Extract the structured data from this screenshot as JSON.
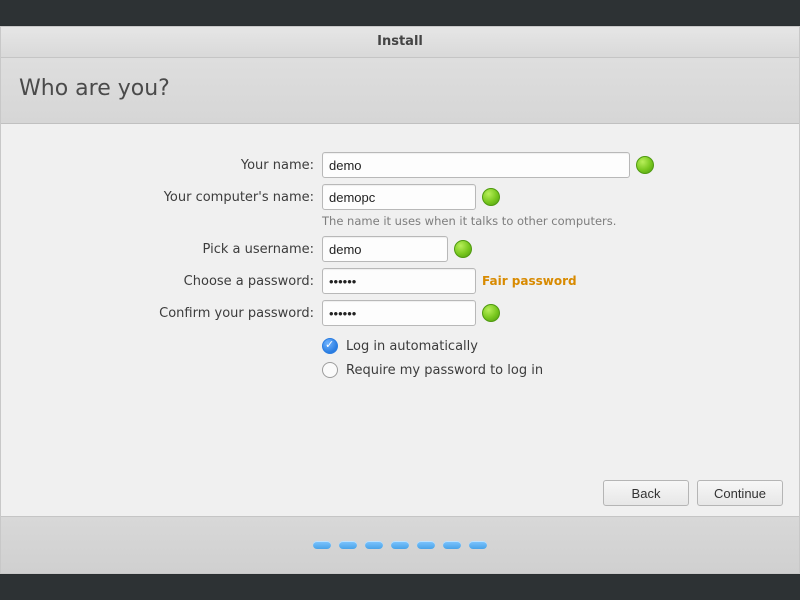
{
  "window": {
    "title": "Install"
  },
  "header": {
    "title": "Who are you?"
  },
  "form": {
    "name": {
      "label": "Your name:",
      "value": "demo"
    },
    "host": {
      "label": "Your computer's name:",
      "value": "demopc",
      "hint": "The name it uses when it talks to other computers."
    },
    "user": {
      "label": "Pick a username:",
      "value": "demo"
    },
    "password": {
      "label": "Choose a password:",
      "value": "••••••",
      "strength": "Fair password"
    },
    "confirm": {
      "label": "Confirm your password:",
      "value": "••••••"
    },
    "login_auto": {
      "label": "Log in automatically",
      "checked": true
    },
    "login_pass": {
      "label": "Require my password to log in",
      "checked": false
    }
  },
  "buttons": {
    "back": "Back",
    "continue": "Continue"
  },
  "progress": {
    "dots": 7
  }
}
